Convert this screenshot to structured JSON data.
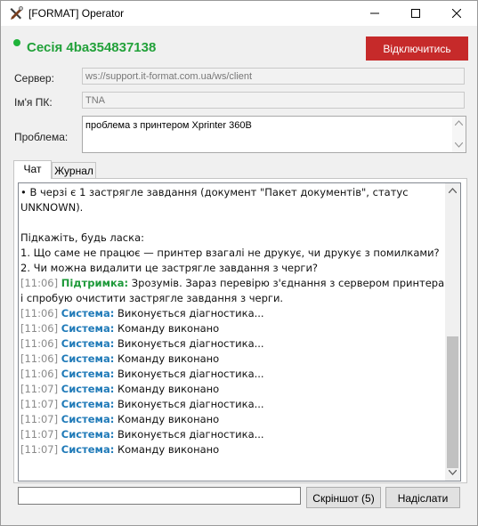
{
  "window": {
    "title": "[FORMAT] Operator"
  },
  "session": {
    "label": "Сесія 4ba354837138",
    "disconnect_label": "Відключитись"
  },
  "fields": {
    "server_label": "Сервер:",
    "server_value": "ws://support.it-format.com.ua/ws/client",
    "pc_label": "Ім'я ПК:",
    "pc_value": "TNA",
    "problem_label": "Проблема:",
    "problem_value": "проблема з принтером Xprinter 360B"
  },
  "tabs": [
    "Чат",
    "Журнал"
  ],
  "chat": {
    "lines": [
      {
        "text": "• В черзі є 1 застрягле завдання (документ \"Пакет документів\", статус"
      },
      {
        "text": "UNKNOWN)."
      },
      {
        "text": ""
      },
      {
        "text": "Підкажіть, будь ласка:"
      },
      {
        "text": "1. Що саме не працює — принтер взагалі не друкує, чи друкує з помилками?"
      },
      {
        "text": "2. Чи можна видалити це застрягле завдання з черги?"
      },
      {
        "time": "[11:06]",
        "sender": "Підтримка:",
        "role": "support",
        "text": " Зрозумів. Зараз перевірю з'єднання з сервером принтера"
      },
      {
        "text": "і спробую очистити застрягле завдання з черги."
      },
      {
        "time": "[11:06]",
        "sender": "Система:",
        "role": "system",
        "text": " Виконується діагностика..."
      },
      {
        "time": "[11:06]",
        "sender": "Система:",
        "role": "system",
        "text": " Команду виконано"
      },
      {
        "time": "[11:06]",
        "sender": "Система:",
        "role": "system",
        "text": " Виконується діагностика..."
      },
      {
        "time": "[11:06]",
        "sender": "Система:",
        "role": "system",
        "text": " Команду виконано"
      },
      {
        "time": "[11:06]",
        "sender": "Система:",
        "role": "system",
        "text": " Виконується діагностика..."
      },
      {
        "time": "[11:07]",
        "sender": "Система:",
        "role": "system",
        "text": " Команду виконано"
      },
      {
        "time": "[11:07]",
        "sender": "Система:",
        "role": "system",
        "text": " Виконується діагностика..."
      },
      {
        "time": "[11:07]",
        "sender": "Система:",
        "role": "system",
        "text": " Команду виконано"
      },
      {
        "time": "[11:07]",
        "sender": "Система:",
        "role": "system",
        "text": " Виконується діагностика..."
      },
      {
        "time": "[11:07]",
        "sender": "Система:",
        "role": "system",
        "text": " Команду виконано"
      }
    ]
  },
  "input": {
    "value": ""
  },
  "buttons": {
    "screenshot_label": "Скріншот (5)",
    "send_label": "Надіслати"
  },
  "colors": {
    "accent_green": "#22a13a",
    "danger_red": "#c62a2a",
    "system_blue": "#1f7ab8"
  }
}
